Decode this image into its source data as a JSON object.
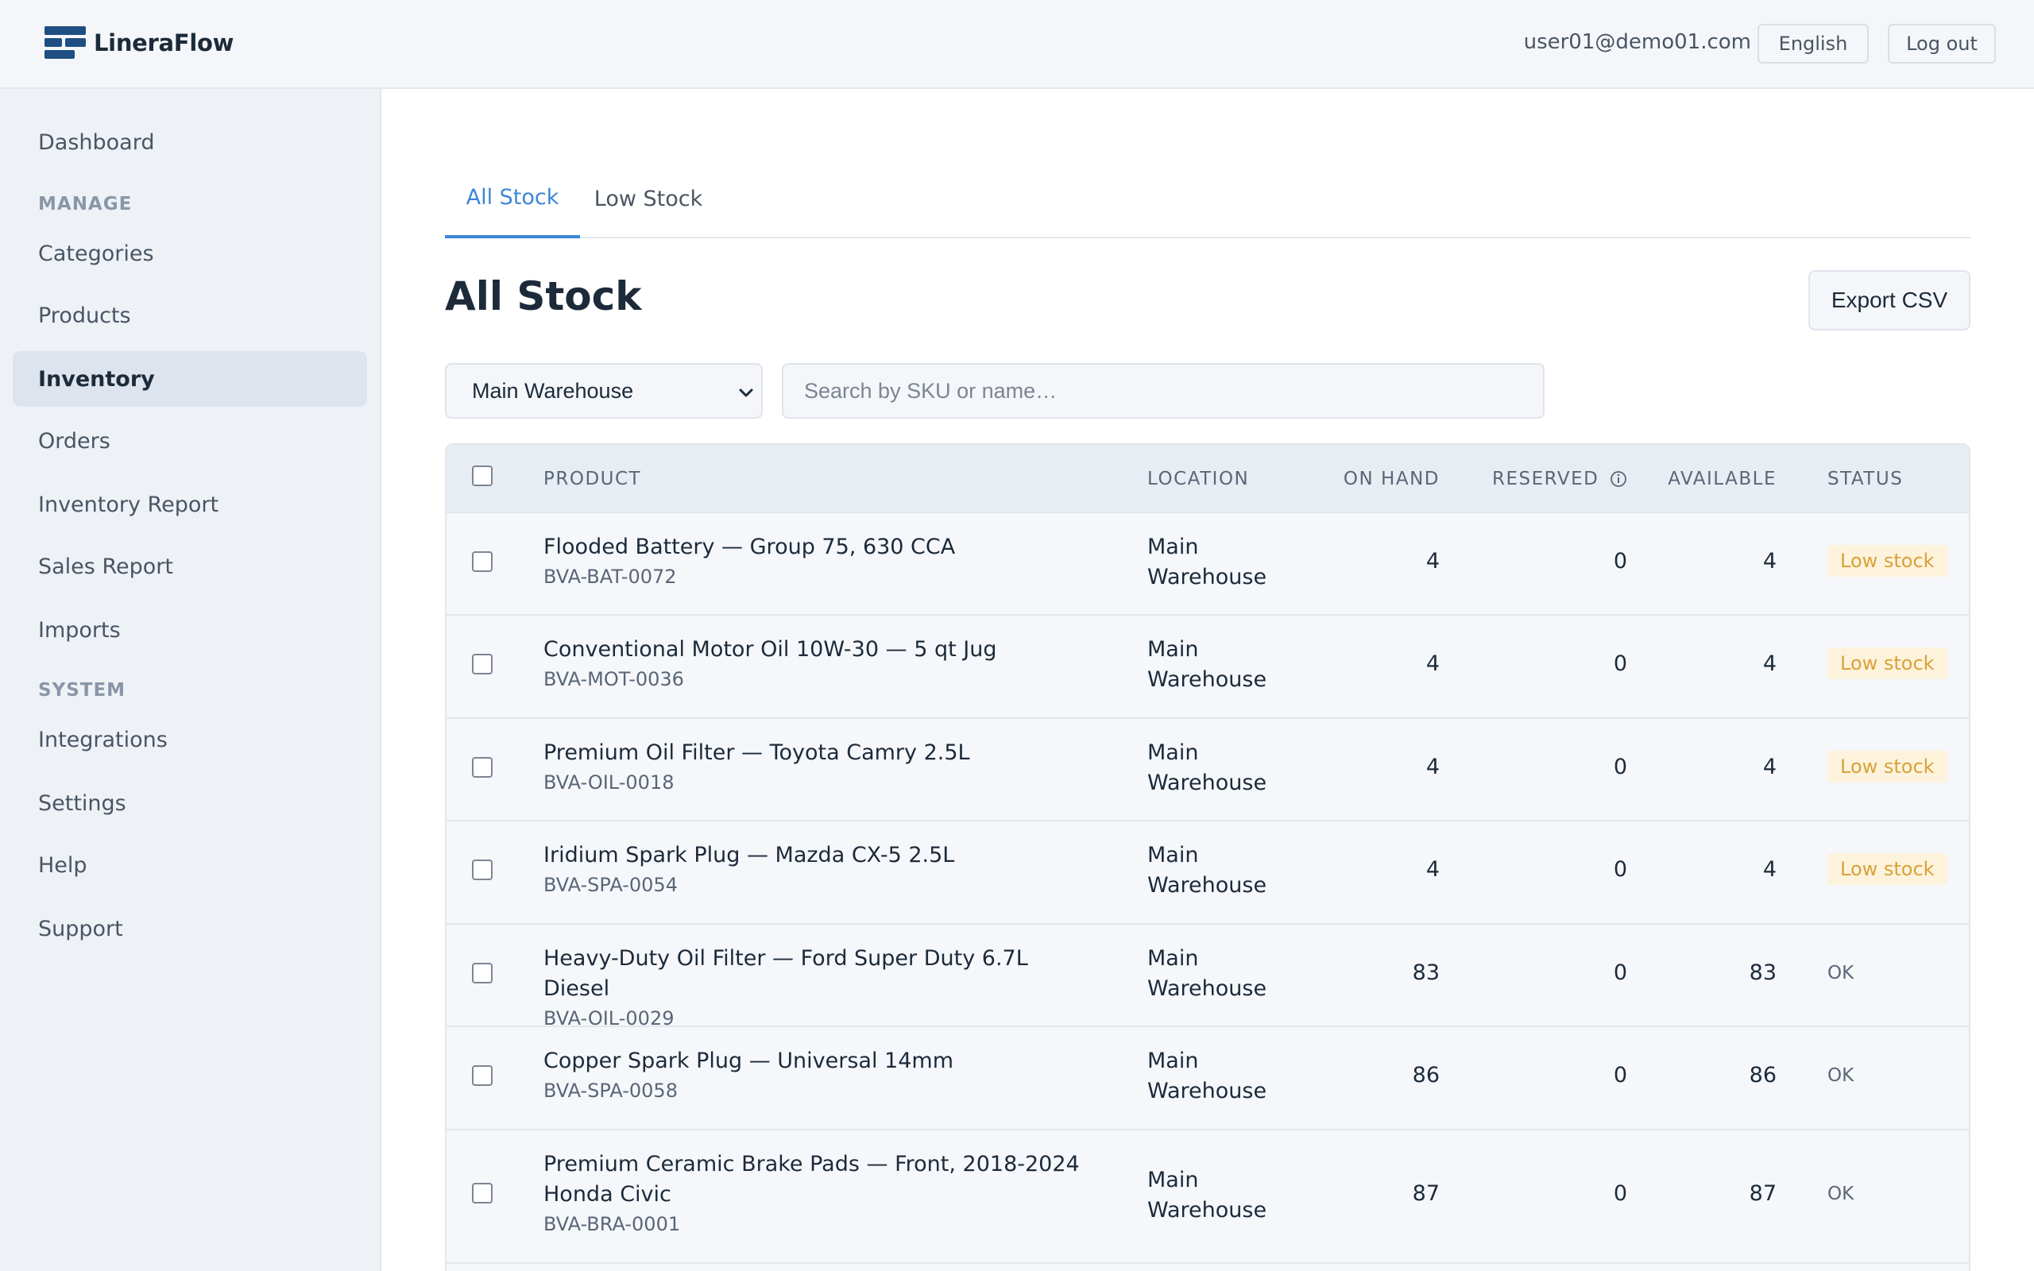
{
  "header": {
    "brand": "LineraFlow",
    "user_email": "user01@demo01.com",
    "language_label": "English",
    "logout_label": "Log out"
  },
  "sidebar": {
    "items": [
      {
        "label": "Dashboard"
      },
      {
        "label": "Categories"
      },
      {
        "label": "Products"
      },
      {
        "label": "Inventory"
      },
      {
        "label": "Orders"
      },
      {
        "label": "Inventory Report"
      },
      {
        "label": "Sales Report"
      },
      {
        "label": "Imports"
      },
      {
        "label": "Integrations"
      },
      {
        "label": "Settings"
      },
      {
        "label": "Help"
      },
      {
        "label": "Support"
      }
    ],
    "sections": [
      "MANAGE",
      "SYSTEM"
    ],
    "active": "Inventory"
  },
  "tabs": [
    {
      "label": "All Stock",
      "active": true
    },
    {
      "label": "Low Stock",
      "active": false
    }
  ],
  "page": {
    "title": "All Stock",
    "export_label": "Export CSV"
  },
  "filters": {
    "warehouse": "Main Warehouse",
    "search_placeholder": "Search by SKU or name…",
    "search_value": ""
  },
  "table": {
    "columns": [
      "PRODUCT",
      "LOCATION",
      "ON HAND",
      "RESERVED",
      "AVAILABLE",
      "STATUS"
    ],
    "rows": [
      {
        "name": "Flooded Battery — Group 75, 630 CCA",
        "sku": "BVA-BAT-0072",
        "location": "Main Warehouse",
        "on_hand": "4",
        "reserved": "0",
        "available": "4",
        "status": "Low stock"
      },
      {
        "name": "Conventional Motor Oil 10W-30 — 5 qt Jug",
        "sku": "BVA-MOT-0036",
        "location": "Main Warehouse",
        "on_hand": "4",
        "reserved": "0",
        "available": "4",
        "status": "Low stock"
      },
      {
        "name": "Premium Oil Filter — Toyota Camry 2.5L",
        "sku": "BVA-OIL-0018",
        "location": "Main Warehouse",
        "on_hand": "4",
        "reserved": "0",
        "available": "4",
        "status": "Low stock"
      },
      {
        "name": "Iridium Spark Plug — Mazda CX-5 2.5L",
        "sku": "BVA-SPA-0054",
        "location": "Main Warehouse",
        "on_hand": "4",
        "reserved": "0",
        "available": "4",
        "status": "Low stock"
      },
      {
        "name": "Heavy-Duty Oil Filter — Ford Super Duty 6.7L Diesel",
        "sku": "BVA-OIL-0029",
        "location": "Main Warehouse",
        "on_hand": "83",
        "reserved": "0",
        "available": "83",
        "status": "OK"
      },
      {
        "name": "Copper Spark Plug — Universal 14mm",
        "sku": "BVA-SPA-0058",
        "location": "Main Warehouse",
        "on_hand": "86",
        "reserved": "0",
        "available": "86",
        "status": "OK"
      },
      {
        "name": "Premium Ceramic Brake Pads — Front, 2018-2024 Honda Civic",
        "sku": "BVA-BRA-0001",
        "location": "Main Warehouse",
        "on_hand": "87",
        "reserved": "0",
        "available": "87",
        "status": "OK"
      }
    ]
  },
  "colors": {
    "accent": "#3d86d6",
    "brand": "#1f4f82",
    "low_stock_bg": "#fdf3dc",
    "low_stock_text": "#d9a13a"
  },
  "icons": [
    "brand-logo-icon",
    "chevron-down-icon",
    "info-icon",
    "checkbox-icon"
  ]
}
